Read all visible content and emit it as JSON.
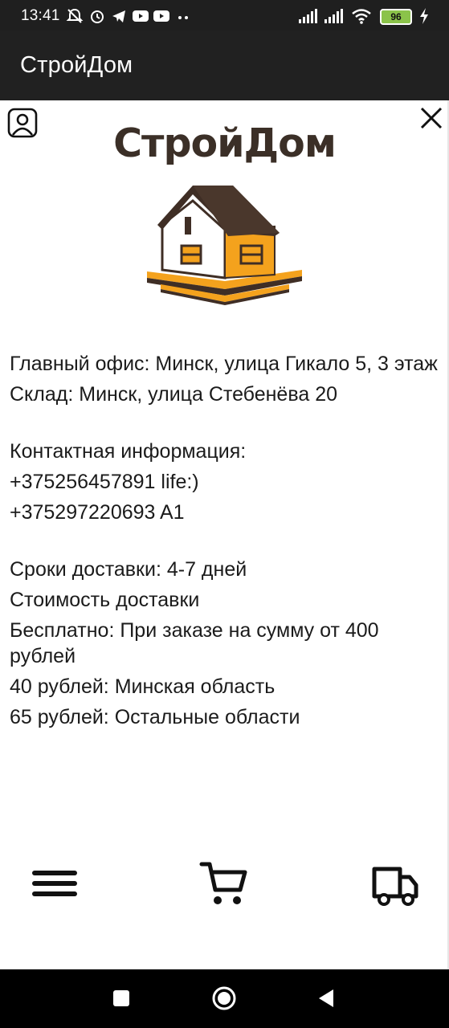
{
  "status_bar": {
    "time": "13:41",
    "battery": "96",
    "icons_left": [
      "mute-icon",
      "alarm-icon",
      "telegram-icon",
      "youtube-icon",
      "youtube-icon",
      "more-icon"
    ],
    "icons_right": [
      "signal-icon",
      "signal-icon",
      "wifi-icon",
      "battery-icon",
      "charging-icon"
    ]
  },
  "app_bar": {
    "title": "СтройДом"
  },
  "header": {
    "logo_text": "СтройДом",
    "profile_icon": "profile-icon",
    "close_icon": "close-icon"
  },
  "info": {
    "main_office": "Главный офис: Минск, улица Гикало 5, 3 этаж",
    "warehouse": "Склад: Минск, улица Стебенёва 20",
    "contacts_title": "Контактная информация:",
    "phone_1": "+375256457891  life:)",
    "phone_2": "+375297220693  A1",
    "delivery_time": "Сроки доставки: 4-7 дней",
    "delivery_cost_title": "Стоимость доставки",
    "free_delivery": "Бесплатно: При заказе на сумму от 400 рублей",
    "minsk_region": "40 рублей: Минская область",
    "other_regions": "65 рублей: Остальные области"
  },
  "bottom_nav": [
    "menu-icon",
    "cart-icon",
    "delivery-truck-icon"
  ],
  "system_nav": [
    "recents-square-icon",
    "home-circle-icon",
    "back-triangle-icon"
  ],
  "colors": {
    "app_bar": "#212121",
    "logo_text": "#3b2f27",
    "logo_orange": "#f4a21d",
    "logo_roof": "#3f2e25"
  }
}
